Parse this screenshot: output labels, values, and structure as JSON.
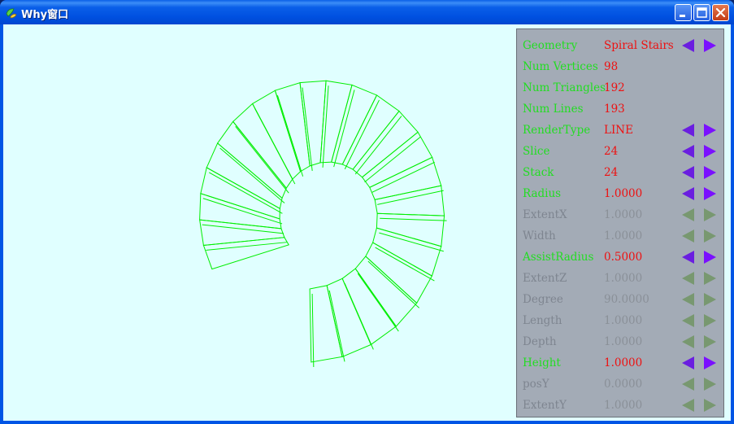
{
  "window": {
    "title": "Why窗口"
  },
  "colors": {
    "label_enabled": "#22dd22",
    "value_enabled": "#ee1111",
    "label_disabled": "#7e8590",
    "value_disabled": "#8a9098",
    "arrow_enabled_left": "#6a1ee0",
    "arrow_enabled_right": "#7a10ff",
    "arrow_disabled": "#789870",
    "wireframe": "#00ee00",
    "viewport_bg": "#e0ffff",
    "panel_bg": "#a3abb6"
  },
  "panel": {
    "rows": [
      {
        "label": "Geometry",
        "value": "Spiral Stairs",
        "enabled": true,
        "arrows": true
      },
      {
        "label": "Num Vertices",
        "value": "98",
        "enabled": true,
        "arrows": false
      },
      {
        "label": "Num Triangles",
        "value": "192",
        "enabled": true,
        "arrows": false
      },
      {
        "label": "Num Lines",
        "value": "193",
        "enabled": true,
        "arrows": false
      },
      {
        "label": "RenderType",
        "value": "LINE",
        "enabled": true,
        "arrows": true
      },
      {
        "label": "Slice",
        "value": "24",
        "enabled": true,
        "arrows": true
      },
      {
        "label": "Stack",
        "value": "24",
        "enabled": true,
        "arrows": true
      },
      {
        "label": "Radius",
        "value": "1.0000",
        "enabled": true,
        "arrows": true
      },
      {
        "label": "ExtentX",
        "value": "1.0000",
        "enabled": false,
        "arrows": true
      },
      {
        "label": "Width",
        "value": "1.0000",
        "enabled": false,
        "arrows": true
      },
      {
        "label": "AssistRadius",
        "value": "0.5000",
        "enabled": true,
        "arrows": true
      },
      {
        "label": "ExtentZ",
        "value": "1.0000",
        "enabled": false,
        "arrows": true
      },
      {
        "label": "Degree",
        "value": "90.0000",
        "enabled": false,
        "arrows": true
      },
      {
        "label": "Length",
        "value": "1.0000",
        "enabled": false,
        "arrows": true
      },
      {
        "label": "Depth",
        "value": "1.0000",
        "enabled": false,
        "arrows": true
      },
      {
        "label": "Height",
        "value": "1.0000",
        "enabled": true,
        "arrows": true
      },
      {
        "label": "posY",
        "value": "0.0000",
        "enabled": false,
        "arrows": true
      },
      {
        "label": "ExtentY",
        "value": "1.0000",
        "enabled": false,
        "arrows": true
      }
    ]
  }
}
